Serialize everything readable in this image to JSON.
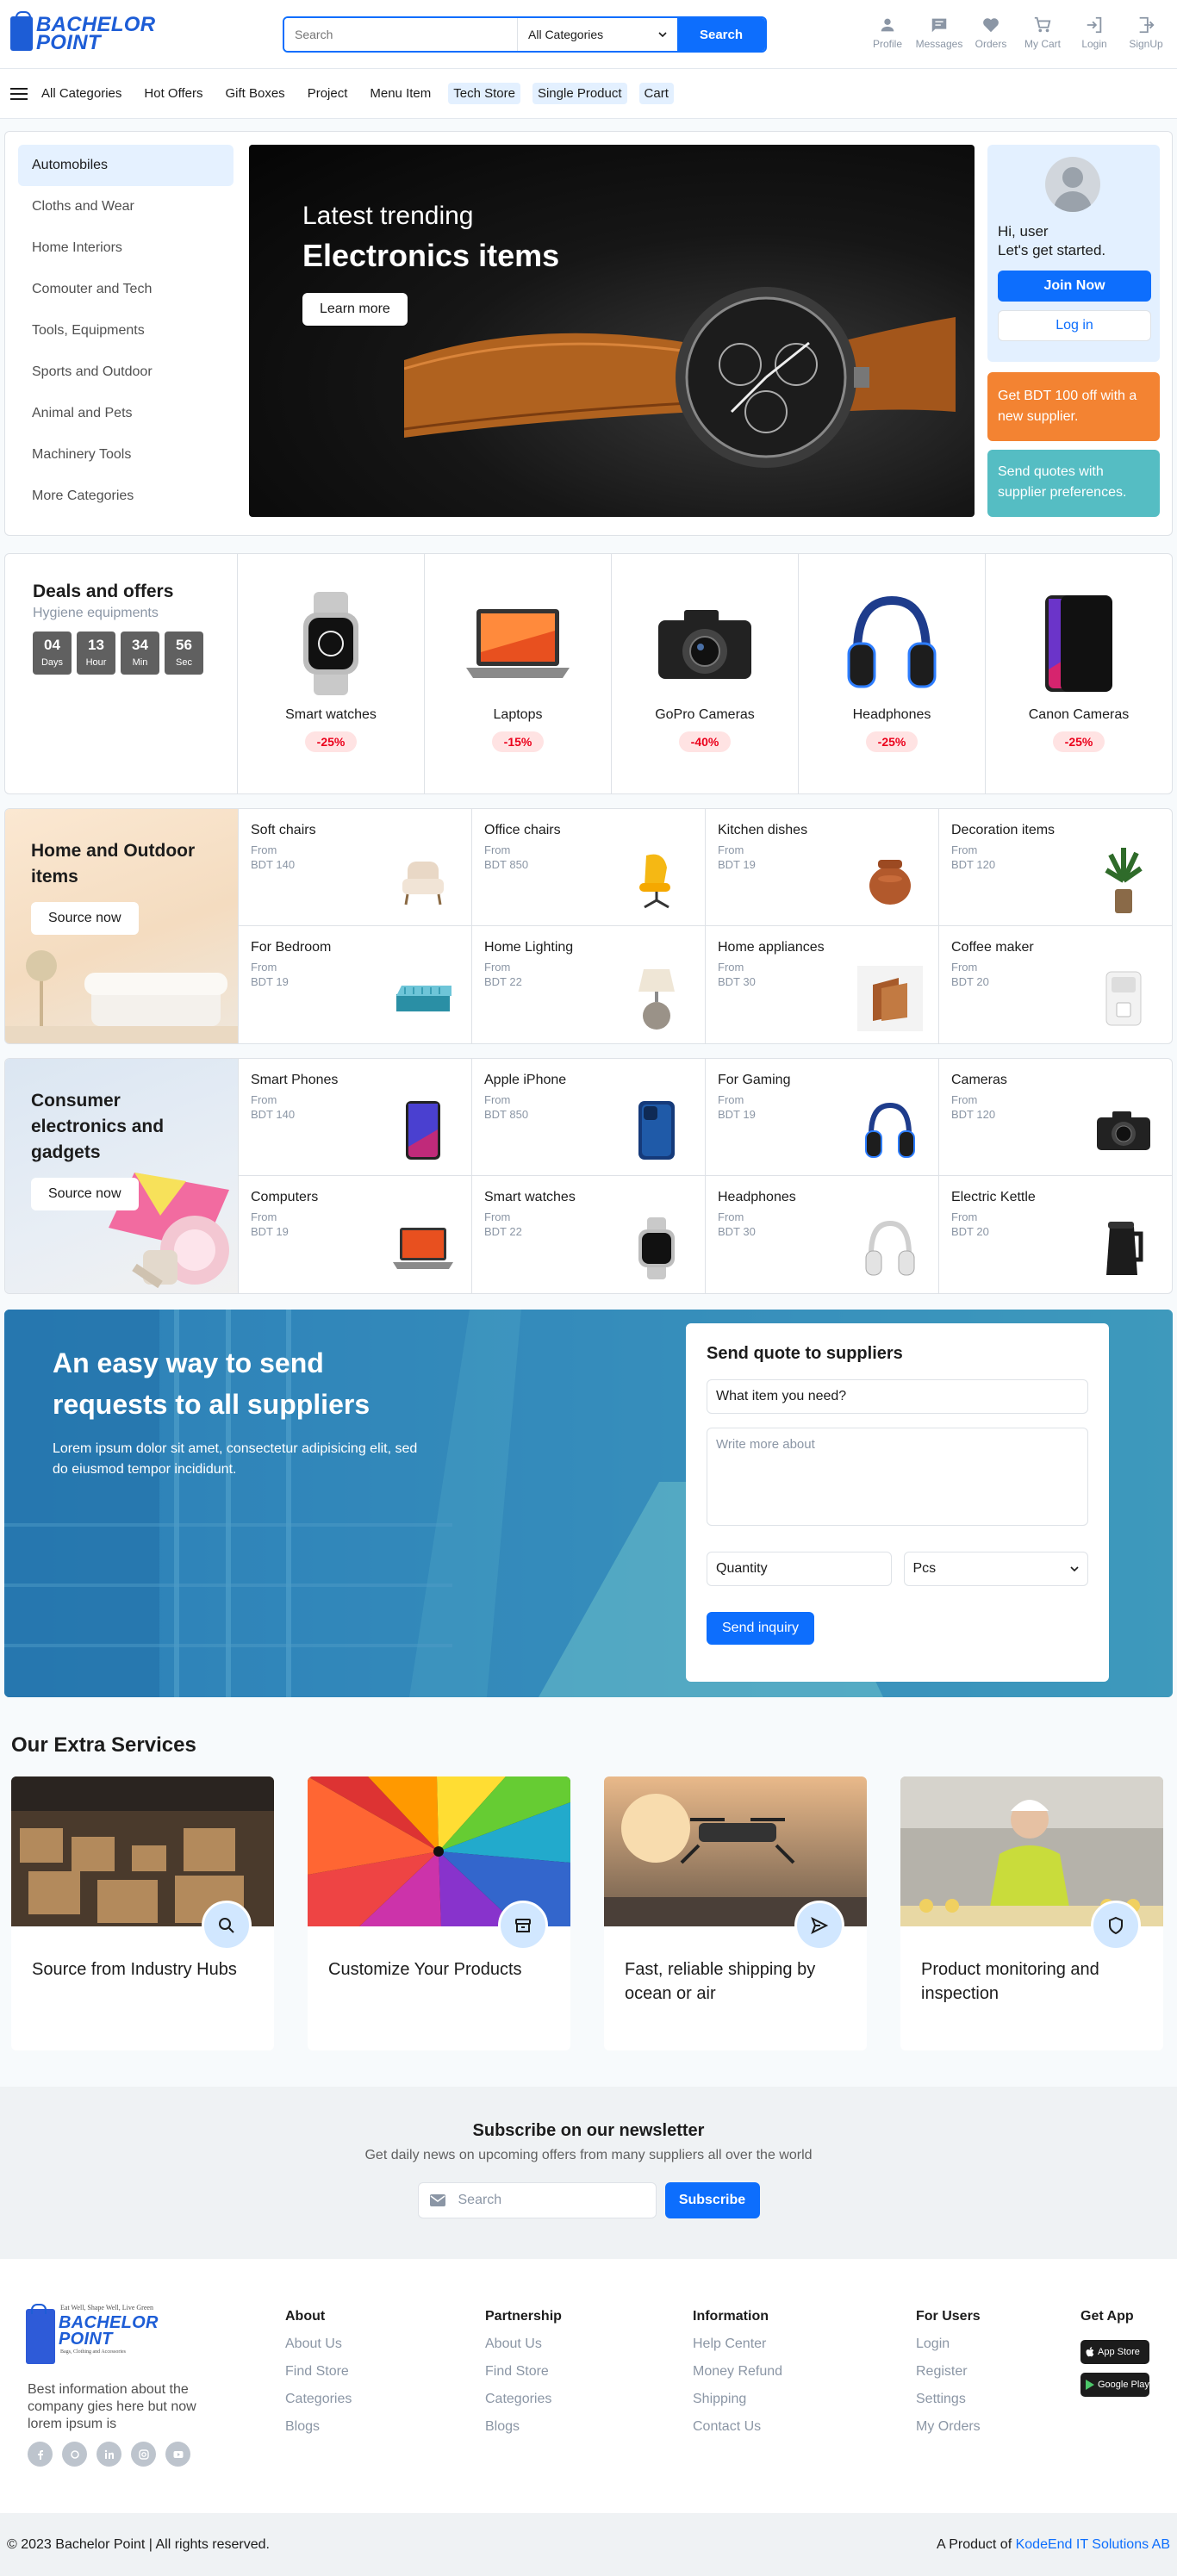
{
  "header": {
    "logo_line1": "BACHELOR",
    "logo_line2": "POINT",
    "search_placeholder": "Search",
    "category_select": "All Categories",
    "search_button": "Search",
    "actions": [
      "Profile",
      "Messages",
      "Orders",
      "My Cart",
      "Login",
      "SignUp"
    ]
  },
  "nav": {
    "items": [
      "All Categories",
      "Hot Offers",
      "Gift Boxes",
      "Project",
      "Menu Item",
      "Tech Store",
      "Single Product",
      "Cart"
    ]
  },
  "hero": {
    "categories": [
      "Automobiles",
      "Cloths and Wear",
      "Home Interiors",
      "Comouter and Tech",
      "Tools, Equipments",
      "Sports and Outdoor",
      "Animal and Pets",
      "Machinery Tools",
      "More Categories"
    ],
    "banner_line1": "Latest trending",
    "banner_line2": "Electronics items",
    "banner_button": "Learn more",
    "greeting": "Hi, user\nLet's get started.",
    "join_button": "Join Now",
    "login_button": "Log in",
    "promo_orange": "Get BDT 100 off with a new supplier.",
    "promo_teal": "Send quotes with supplier preferences.",
    "accent_orange": "#f38332",
    "accent_teal": "#55bdc3"
  },
  "deals": {
    "title": "Deals and offers",
    "subtitle": "Hygiene equipments",
    "timer": [
      {
        "value": "04",
        "unit": "Days"
      },
      {
        "value": "13",
        "unit": "Hour"
      },
      {
        "value": "34",
        "unit": "Min"
      },
      {
        "value": "56",
        "unit": "Sec"
      }
    ],
    "items": [
      {
        "name": "Smart watches",
        "discount": "-25%",
        "icon": "watch-icon"
      },
      {
        "name": "Laptops",
        "discount": "-15%",
        "icon": "laptop-icon"
      },
      {
        "name": "GoPro Cameras",
        "discount": "-40%",
        "icon": "camera-icon"
      },
      {
        "name": "Headphones",
        "discount": "-25%",
        "icon": "headphones-icon"
      },
      {
        "name": "Canon Cameras",
        "discount": "-25%",
        "icon": "phone-icon"
      }
    ]
  },
  "home_outdoor": {
    "title": "Home and Outdoor items",
    "button": "Source now",
    "items": [
      {
        "name": "Soft chairs",
        "from": "From",
        "price": "BDT 140"
      },
      {
        "name": "Office chairs",
        "from": "From",
        "price": "BDT 850"
      },
      {
        "name": "Kitchen dishes",
        "from": "From",
        "price": "BDT 19"
      },
      {
        "name": "Decoration items",
        "from": "From",
        "price": "BDT 120"
      },
      {
        "name": "For Bedroom",
        "from": "From",
        "price": "BDT 19"
      },
      {
        "name": "Home Lighting",
        "from": "From",
        "price": "BDT 22"
      },
      {
        "name": "Home appliances",
        "from": "From",
        "price": "BDT 30"
      },
      {
        "name": "Coffee maker",
        "from": "From",
        "price": "BDT 20"
      }
    ]
  },
  "electronics": {
    "title": "Consumer electronics and gadgets",
    "button": "Source now",
    "items": [
      {
        "name": "Smart Phones",
        "from": "From",
        "price": "BDT 140"
      },
      {
        "name": "Apple iPhone",
        "from": "From",
        "price": "BDT 850"
      },
      {
        "name": "For Gaming",
        "from": "From",
        "price": "BDT 19"
      },
      {
        "name": "Cameras",
        "from": "From",
        "price": "BDT 120"
      },
      {
        "name": "Computers",
        "from": "From",
        "price": "BDT 19"
      },
      {
        "name": "Smart watches",
        "from": "From",
        "price": "BDT 22"
      },
      {
        "name": "Headphones",
        "from": "From",
        "price": "BDT 30"
      },
      {
        "name": "Electric Kettle",
        "from": "From",
        "price": "BDT 20"
      }
    ]
  },
  "quote": {
    "heading": "An easy way to send\nrequests to all suppliers",
    "text": "Lorem ipsum dolor sit amet, consectetur adipisicing elit, sed do eiusmod tempor incididunt.",
    "form_title": "Send quote to suppliers",
    "item_value": "What item you need?",
    "more_placeholder": "Write more about",
    "quantity_value": "Quantity",
    "unit_select": "Pcs",
    "send_button": "Send inquiry"
  },
  "services": {
    "title": "Our Extra Services",
    "items": [
      {
        "label": "Source from Industry Hubs",
        "icon": "search-icon"
      },
      {
        "label": "Customize Your Products",
        "icon": "archive-icon"
      },
      {
        "label": "Fast, reliable shipping by ocean or air",
        "icon": "send-icon"
      },
      {
        "label": "Product monitoring and inspection",
        "icon": "shield-icon"
      }
    ]
  },
  "newsletter": {
    "title": "Subscribe on our newsletter",
    "subtitle": "Get daily news on upcoming offers from many suppliers all over the world",
    "placeholder": "Search",
    "button": "Subscribe"
  },
  "footer": {
    "tagline": "Eat Well, Shape Well, Live Green",
    "logo_line1": "BACHELOR",
    "logo_line2": "POINT",
    "logo_small": "Bags, Clothing and Accessories",
    "description": "Best information about the company gies here but now lorem ipsum is",
    "columns": [
      {
        "title": "About",
        "links": [
          "About Us",
          "Find Store",
          "Categories",
          "Blogs"
        ]
      },
      {
        "title": "Partnership",
        "links": [
          "About Us",
          "Find Store",
          "Categories",
          "Blogs"
        ]
      },
      {
        "title": "Information",
        "links": [
          "Help Center",
          "Money Refund",
          "Shipping",
          "Contact Us"
        ]
      },
      {
        "title": "For Users",
        "links": [
          "Login",
          "Register",
          "Settings",
          "My Orders"
        ]
      }
    ],
    "get_app": "Get App",
    "app_store": "App Store",
    "google_play": "Google Play",
    "copyright": "© 2023 Bachelor Point | All rights reserved.",
    "product_of": "A Product of",
    "company": "KodeEnd IT Solutions AB"
  }
}
